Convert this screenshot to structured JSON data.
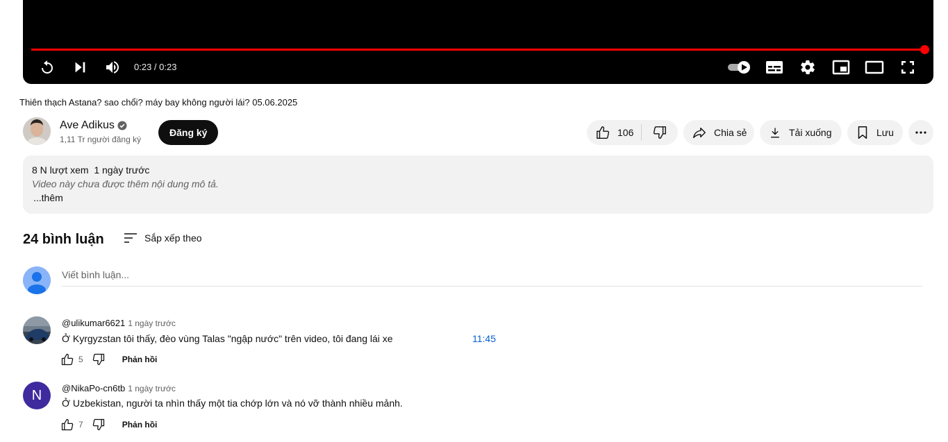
{
  "player": {
    "time_display": "0:23 / 0:23",
    "progress_fraction": 1.0,
    "icons": [
      "replay-icon",
      "next-icon",
      "volume-icon",
      "autoplay-toggle-icon",
      "subtitles-icon",
      "settings-icon",
      "miniplayer-icon",
      "theater-mode-icon",
      "fullscreen-icon"
    ]
  },
  "video": {
    "title": "Thiên thạch Astana? sao chổi? máy bay không người lái? 05.06.2025"
  },
  "channel": {
    "name": "Ave Adikus",
    "subscribers": "1,11 Tr người đăng ký",
    "subscribe_label": "Đăng ký"
  },
  "actions": {
    "likes": "106",
    "share_label": "Chia sẻ",
    "download_label": "Tải xuống",
    "save_label": "Lưu"
  },
  "description": {
    "meta": "8 N lượt xem  1 ngày trước",
    "text": "Video này chưa được thêm nội dung mô tả.",
    "more": "...thêm"
  },
  "comments": {
    "count_label": "24 bình luận",
    "sort_label": "Sắp xếp theo",
    "input_placeholder": "Viết bình luận...",
    "items": [
      {
        "author": "@ulikumar6621",
        "time": "1 ngày trước",
        "text": "Ở Kyrgyzstan tôi thấy, đèo vùng Talas \"ngập nước\" trên video, tôi đang lái xe",
        "timestamp": "11:45",
        "likes": "5",
        "reply_label": "Phản hồi"
      },
      {
        "author": "@NikaPo-cn6tb",
        "time": "1 ngày trước",
        "initial": "N",
        "text": "Ở Uzbekistan, người ta nhìn thấy một tia chớp lớn và nó vỡ thành nhiều mảnh.",
        "likes": "7",
        "reply_label": "Phản hồi"
      }
    ]
  },
  "colors": {
    "progress": "#ff0000",
    "subscribe_bg": "#0f0f0f",
    "pill_bg": "#f2f2f2",
    "link": "#065fd4",
    "avatar_n": "#3f2a9e"
  }
}
